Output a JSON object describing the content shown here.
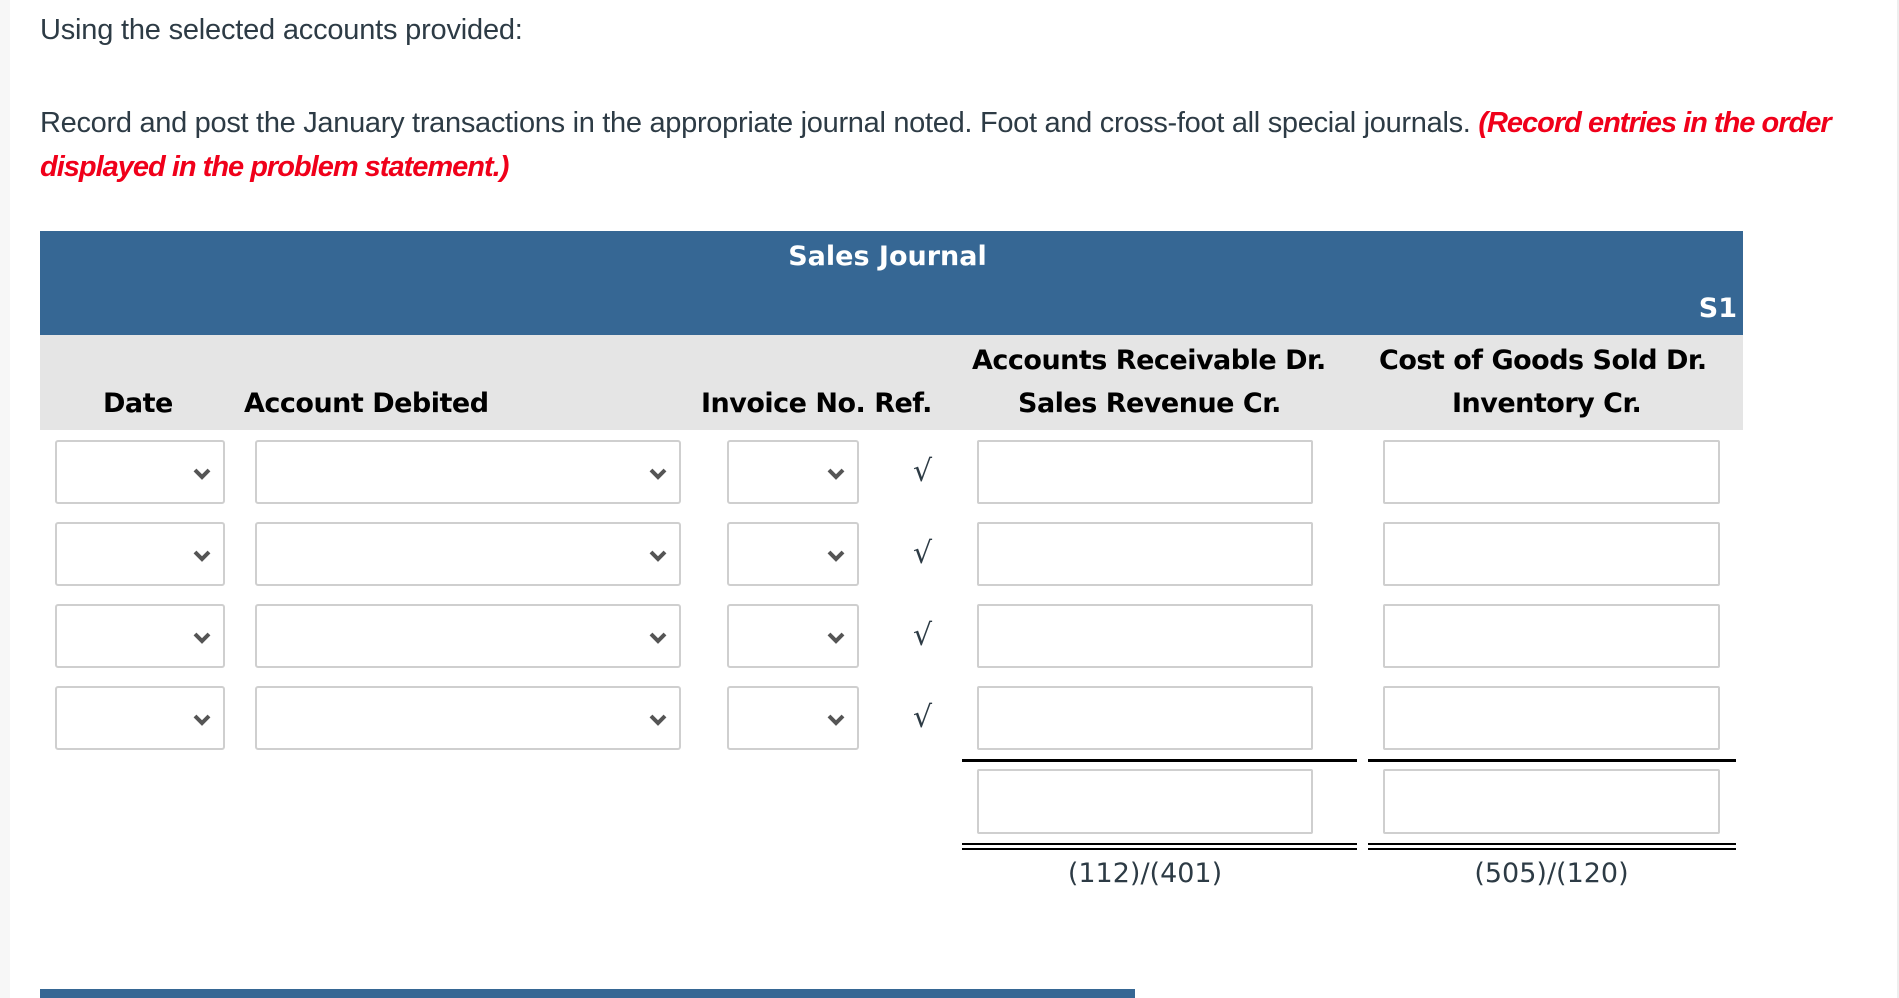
{
  "instructions": {
    "intro": "Using the selected accounts provided:",
    "body": "Record and post the January transactions in the appropriate journal noted. Foot and cross-foot all special journals. ",
    "emphasis": "(Record entries in the order displayed in the problem statement.)"
  },
  "journal": {
    "title": "Sales Journal",
    "code": "S1",
    "columns": {
      "date": "Date",
      "account_debited": "Account Debited",
      "invoice_ref": "Invoice No. Ref.",
      "ar_line1": "Accounts Receivable Dr.",
      "ar_line2": "Sales Revenue Cr.",
      "cogs_line1": "Cost of Goods Sold Dr.",
      "cogs_line2": "Inventory Cr."
    },
    "rows": [
      {
        "date": "",
        "account_debited": "",
        "invoice_no": "",
        "ref": "√",
        "ar_sales": "",
        "cogs_inventory": ""
      },
      {
        "date": "",
        "account_debited": "",
        "invoice_no": "",
        "ref": "√",
        "ar_sales": "",
        "cogs_inventory": ""
      },
      {
        "date": "",
        "account_debited": "",
        "invoice_no": "",
        "ref": "√",
        "ar_sales": "",
        "cogs_inventory": ""
      },
      {
        "date": "",
        "account_debited": "",
        "invoice_no": "",
        "ref": "√",
        "ar_sales": "",
        "cogs_inventory": ""
      }
    ],
    "totals": {
      "ar_sales": "",
      "cogs_inventory": ""
    },
    "posting_refs": {
      "ar_sales": "(112)/(401)",
      "cogs_inventory": "(505)/(120)"
    }
  },
  "colors": {
    "header_band": "#366794",
    "column_header_bg": "#e5e5e5",
    "emphasis_text": "#f0001a",
    "body_text": "#2d3b45"
  }
}
